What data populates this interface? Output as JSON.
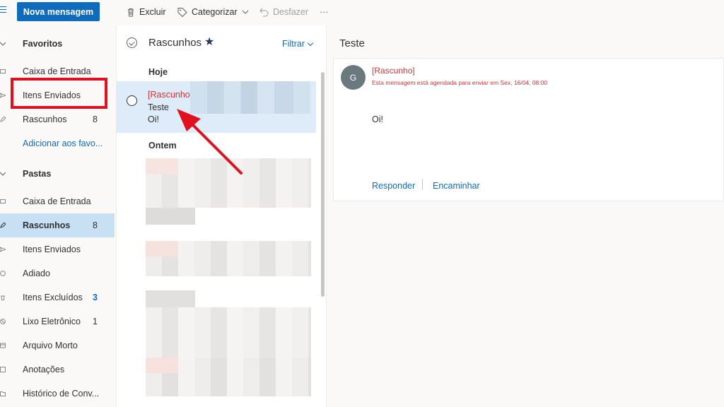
{
  "toolbar": {
    "new_message": "Nova mensagem",
    "delete": "Excluir",
    "categorize": "Categorizar",
    "undo": "Desfazer",
    "more": "···"
  },
  "nav": {
    "favorites_header": "Favoritos",
    "favorites": [
      {
        "label": "Caixa de Entrada",
        "count": ""
      },
      {
        "label": "Itens Enviados",
        "count": ""
      },
      {
        "label": "Rascunhos",
        "count": "8"
      }
    ],
    "add_favorite": "Adicionar aos favo...",
    "folders_header": "Pastas",
    "folders": [
      {
        "label": "Caixa de Entrada",
        "count": ""
      },
      {
        "label": "Rascunhos",
        "count": "8"
      },
      {
        "label": "Itens Enviados",
        "count": ""
      },
      {
        "label": "Adiado",
        "count": ""
      },
      {
        "label": "Itens Excluídos",
        "count": "3"
      },
      {
        "label": "Lixo Eletrônico",
        "count": "1"
      },
      {
        "label": "Arquivo Morto",
        "count": ""
      },
      {
        "label": "Anotações",
        "count": ""
      },
      {
        "label": "Histórico de Conv...",
        "count": ""
      }
    ]
  },
  "list": {
    "title": "Rascunhos",
    "star": "★",
    "filter": "Filtrar",
    "group_today": "Hoje",
    "group_yesterday": "Ontem",
    "selected_message": {
      "draft_tag": "[Rascunho]",
      "subject": "Teste",
      "preview": "Oi!"
    }
  },
  "reading": {
    "title": "Teste",
    "avatar_initial": "G",
    "draft_tag": "[Rascunho]",
    "schedule_note": "Esta mensagem está agendada para enviar em Sex, 16/04, 08:00",
    "body": "Oi!",
    "reply": "Responder",
    "forward": "Encaminhar"
  },
  "colors": {
    "accent": "#0f6cbd",
    "selected_bg": "#deecf9",
    "nav_selected_bg": "#c7e0f4",
    "draft_red": "#d13438",
    "highlight_red": "#e0111c"
  }
}
